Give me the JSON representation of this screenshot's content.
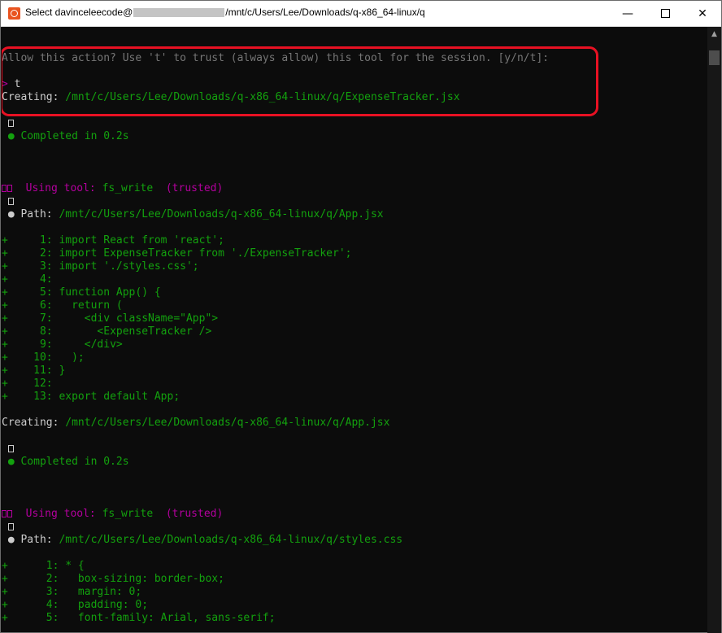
{
  "window": {
    "title_prefix": "Select davinceleecode@",
    "title_suffix": "/mnt/c/Users/Lee/Downloads/q-x86_64-linux/q",
    "minimize": "—",
    "close": "✕"
  },
  "prompt": {
    "question": "Allow this action? Use 't' to trust (always allow) this tool for the session. [y/n/t]:",
    "caret": ">",
    "answer": "t",
    "creating_label": "Creating:",
    "creating_path": "/mnt/c/Users/Lee/Downloads/q-x86_64-linux/q/ExpenseTracker.jsx"
  },
  "completed": {
    "bullet": "●",
    "text": "Completed in 0.2s"
  },
  "tool_blocks": [
    {
      "using_label": "Using tool:",
      "tool_name": "fs_write",
      "trust": "(trusted)",
      "path_bullet": "●",
      "path_label": "Path:",
      "path": "/mnt/c/Users/Lee/Downloads/q-x86_64-linux/q/App.jsx",
      "lines": [
        {
          "plus": "+",
          "num": "     1:",
          "code": " import React from 'react';"
        },
        {
          "plus": "+",
          "num": "     2:",
          "code": " import ExpenseTracker from './ExpenseTracker';"
        },
        {
          "plus": "+",
          "num": "     3:",
          "code": " import './styles.css';"
        },
        {
          "plus": "+",
          "num": "     4:",
          "code": ""
        },
        {
          "plus": "+",
          "num": "     5:",
          "code": " function App() {"
        },
        {
          "plus": "+",
          "num": "     6:",
          "code": "   return ("
        },
        {
          "plus": "+",
          "num": "     7:",
          "code": "     <div className=\"App\">"
        },
        {
          "plus": "+",
          "num": "     8:",
          "code": "       <ExpenseTracker />"
        },
        {
          "plus": "+",
          "num": "     9:",
          "code": "     </div>"
        },
        {
          "plus": "+",
          "num": "    10:",
          "code": "   );"
        },
        {
          "plus": "+",
          "num": "    11:",
          "code": " }"
        },
        {
          "plus": "+",
          "num": "    12:",
          "code": ""
        },
        {
          "plus": "+",
          "num": "    13:",
          "code": " export default App;"
        }
      ],
      "creating_label": "Creating:",
      "creating_path": "/mnt/c/Users/Lee/Downloads/q-x86_64-linux/q/App.jsx"
    },
    {
      "using_label": "Using tool:",
      "tool_name": "fs_write",
      "trust": "(trusted)",
      "path_bullet": "●",
      "path_label": "Path:",
      "path": "/mnt/c/Users/Lee/Downloads/q-x86_64-linux/q/styles.css",
      "lines": [
        {
          "plus": "+",
          "num": "      1:",
          "code": " * {"
        },
        {
          "plus": "+",
          "num": "      2:",
          "code": "   box-sizing: border-box;"
        },
        {
          "plus": "+",
          "num": "      3:",
          "code": "   margin: 0;"
        },
        {
          "plus": "+",
          "num": "      4:",
          "code": "   padding: 0;"
        },
        {
          "plus": "+",
          "num": "      5:",
          "code": "   font-family: Arial, sans-serif;"
        }
      ]
    }
  ]
}
